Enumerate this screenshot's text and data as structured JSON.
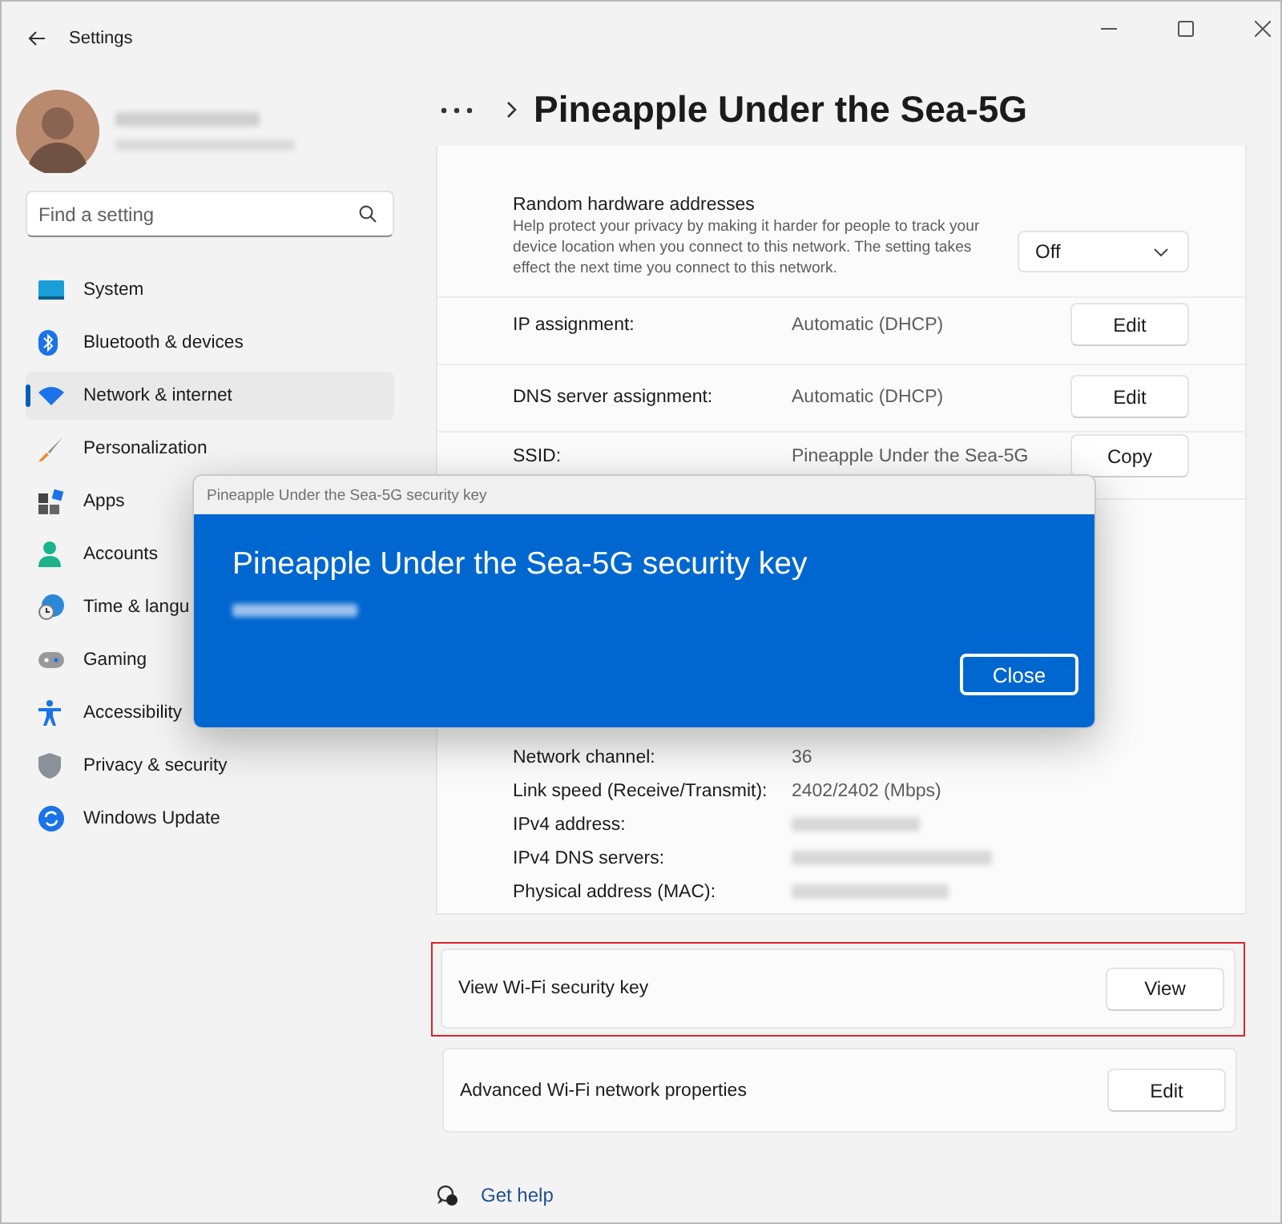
{
  "window": {
    "title": "Settings"
  },
  "search": {
    "placeholder": "Find a setting"
  },
  "nav": [
    {
      "label": "System",
      "selected": false
    },
    {
      "label": "Bluetooth & devices",
      "selected": false
    },
    {
      "label": "Network & internet",
      "selected": true
    },
    {
      "label": "Personalization",
      "selected": false
    },
    {
      "label": "Apps",
      "selected": false
    },
    {
      "label": "Accounts",
      "selected": false
    },
    {
      "label": "Time & langu",
      "selected": false
    },
    {
      "label": "Gaming",
      "selected": false
    },
    {
      "label": "Accessibility",
      "selected": false
    },
    {
      "label": "Privacy & security",
      "selected": false
    },
    {
      "label": "Windows Update",
      "selected": false
    }
  ],
  "page_title": "Pineapple Under the Sea-5G",
  "random_hardware": {
    "label": "Random hardware addresses",
    "description": "Help protect your privacy by making it harder for people to track your device location when you connect to this network. The setting takes effect the next time you connect to this network.",
    "value": "Off"
  },
  "rows": [
    {
      "label": "IP assignment:",
      "value": "Automatic (DHCP)",
      "button": "Edit"
    },
    {
      "label": "DNS server assignment:",
      "value": "Automatic (DHCP)",
      "button": "Edit"
    },
    {
      "label": "SSID:",
      "value": "Pineapple Under the Sea-5G",
      "button": "Copy"
    }
  ],
  "properties": [
    {
      "label": "Network channel:",
      "kind": "text",
      "value": "36"
    },
    {
      "label": "Link speed (Receive/Transmit):",
      "kind": "text",
      "value": "2402/2402 (Mbps)"
    },
    {
      "label": "IPv4 address:",
      "kind": "redacted"
    },
    {
      "label": "IPv4 DNS servers:",
      "kind": "redacted"
    },
    {
      "label": "Physical address (MAC):",
      "kind": "redacted"
    }
  ],
  "security_key_row": {
    "label": "View Wi-Fi security key",
    "button": "View",
    "highlighted": true
  },
  "advanced_row": {
    "label": "Advanced Wi-Fi network properties",
    "button": "Edit"
  },
  "help_link": "Get help",
  "dialog": {
    "title": "Pineapple Under the Sea-5G security key",
    "heading": "Pineapple Under the Sea-5G security key",
    "button": "Close"
  }
}
